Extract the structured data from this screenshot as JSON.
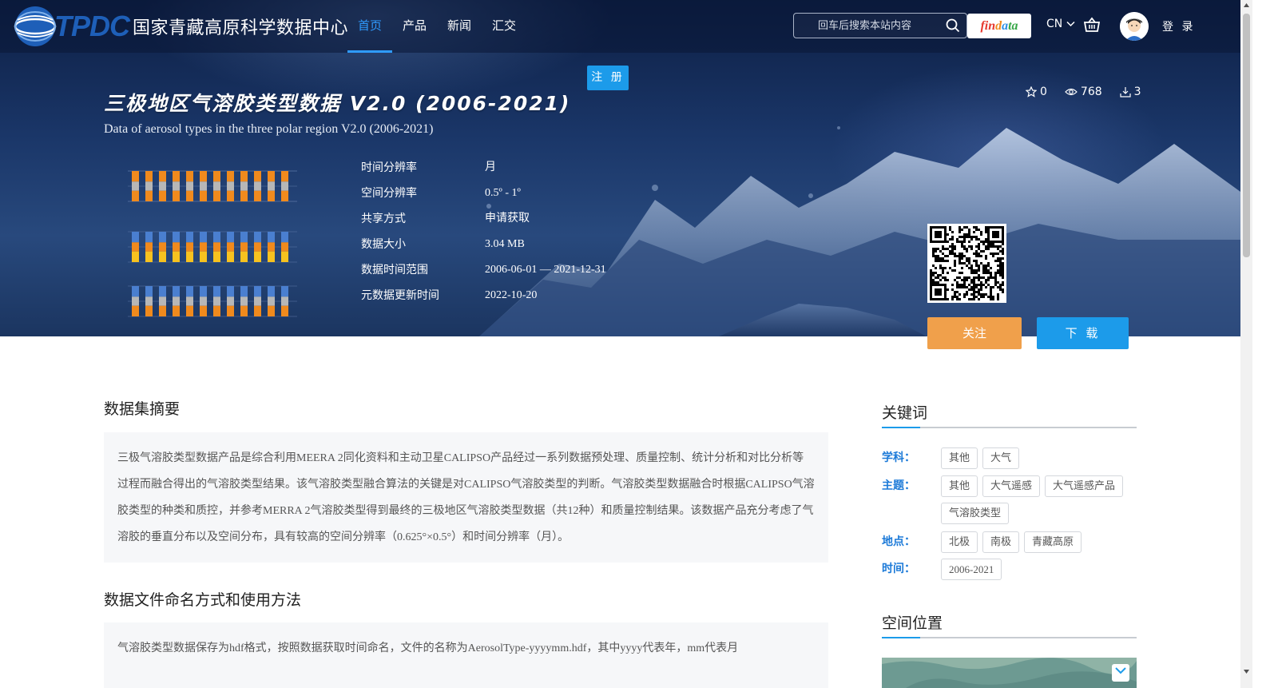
{
  "header": {
    "logo_text": "TPDC",
    "site_name": "国家青藏高原科学数据中心",
    "nav": [
      {
        "label": "首页",
        "active": true
      },
      {
        "label": "产品",
        "active": false
      },
      {
        "label": "新闻",
        "active": false
      },
      {
        "label": "汇交",
        "active": false
      }
    ],
    "search_placeholder": "回车后搜索本站内容",
    "findata": [
      "fin",
      "d",
      "a",
      "ta"
    ],
    "lang": "CN",
    "login": "登 录"
  },
  "hero": {
    "register": "注 册",
    "title_cn": "三极地区气溶胶类型数据 V2.0 (2006-2021)",
    "title_en": "Data of aerosol types in the three polar region V2.0 (2006-2021)",
    "stats": {
      "stars": "0",
      "views": "768",
      "downloads": "3"
    },
    "meta": [
      {
        "label": "时间分辨率",
        "value": "月"
      },
      {
        "label": "空间分辨率",
        "value": "0.5º - 1º"
      },
      {
        "label": "共享方式",
        "value": "申请获取"
      },
      {
        "label": "数据大小",
        "value": "3.04 MB"
      },
      {
        "label": "数据时间范围",
        "value": "2006-06-01 — 2021-12-31"
      },
      {
        "label": "元数据更新时间",
        "value": "2022-10-20"
      }
    ],
    "follow": "关注",
    "download": "下 载"
  },
  "abstract": {
    "title": "数据集摘要",
    "text": "三极气溶胶类型数据产品是综合利用MEERA 2同化资料和主动卫星CALIPSO产品经过一系列数据预处理、质量控制、统计分析和对比分析等过程而融合得出的气溶胶类型结果。该气溶胶类型融合算法的关键是对CALIPSO气溶胶类型的判断。气溶胶类型数据融合时根据CALIPSO气溶胶类型的种类和质控，并参考MERRA 2气溶胶类型得到最终的三极地区气溶胶类型数据（共12种）和质量控制结果。该数据产品充分考虑了气溶胶的垂直分布以及空间分布，具有较高的空间分辨率（0.625°×0.5°）和时间分辨率（月）。"
  },
  "naming": {
    "title": "数据文件命名方式和使用方法",
    "text": "气溶胶类型数据保存为hdf格式，按照数据获取时间命名，文件的名称为AerosolType-yyyymm.hdf，其中yyyy代表年，mm代表月"
  },
  "keywords": {
    "title": "关键词",
    "rows": [
      {
        "label": "学科：",
        "tags": [
          "其他",
          "大气"
        ]
      },
      {
        "label": "主题：",
        "tags": [
          "其他",
          "大气遥感",
          "大气遥感产品",
          "气溶胶类型"
        ]
      },
      {
        "label": "地点：",
        "tags": [
          "北极",
          "南极",
          "青藏高原"
        ]
      },
      {
        "label": "时间：",
        "tags": [
          "2006-2021"
        ]
      }
    ]
  },
  "location": {
    "title": "空间位置"
  },
  "colors": {
    "accent": "#1c9bea",
    "follow": "#f0a04b",
    "nav_active": "#2f9bff",
    "keyword_label": "#1c7ad8"
  }
}
